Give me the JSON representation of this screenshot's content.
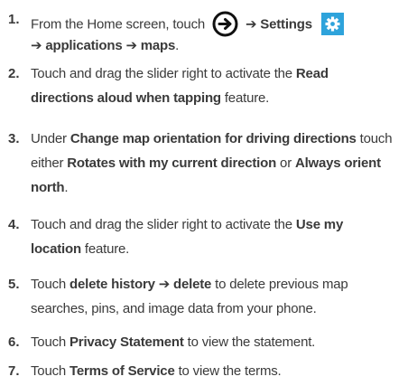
{
  "steps": [
    {
      "number": "1.",
      "text": {
        "a": "From the Home screen, touch",
        "arrow1": "➔",
        "settings": "Settings",
        "arrow2": "➔",
        "applications": "applications",
        "arrow3": "➔",
        "maps": "maps",
        "end": "."
      },
      "icons": [
        "start-arrow-icon",
        "settings-gear-icon"
      ],
      "colors": {
        "settings_icon_bg": "#2ea3db"
      }
    },
    {
      "number": "2.",
      "text": {
        "a": "Touch and drag the slider right to activate the",
        "b1": "Read",
        "b2": "directions aloud when tapping",
        "c": "feature."
      }
    },
    {
      "number": "3.",
      "text": {
        "a": "Under",
        "b": "Change map orientation for driving directions",
        "c": "touch",
        "d": "either",
        "e": "Rotates with my current direction",
        "f": "or",
        "g1": "Always orient",
        "g2": "north",
        "h": "."
      }
    },
    {
      "number": "4.",
      "text": {
        "a": "Touch and drag the slider right to activate the",
        "b1": "Use my",
        "b2": "location",
        "c": "feature."
      }
    },
    {
      "number": "5.",
      "text": {
        "a": "Touch",
        "b": "delete history",
        "arrow": "➔",
        "c": "delete",
        "d": "to delete previous map",
        "e": "searches, pins, and image data from your phone."
      }
    },
    {
      "number": "6.",
      "text": {
        "a": "Touch",
        "b": "Privacy Statement",
        "c": "to view the statement."
      }
    },
    {
      "number": "7.",
      "text": {
        "a": "Touch",
        "b": "Terms of Service",
        "c": "to view the terms."
      }
    }
  ]
}
